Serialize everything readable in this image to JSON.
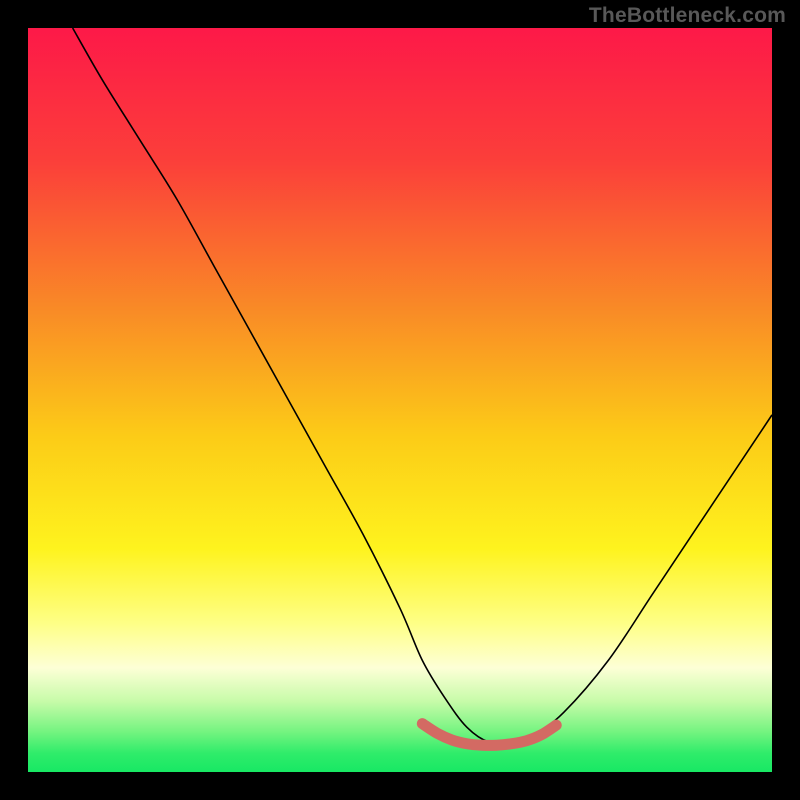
{
  "watermark": "TheBottleneck.com",
  "colors": {
    "black": "#000000",
    "curve": "#000000",
    "salmon": "#d36a63",
    "green": "#18e864"
  },
  "chart_data": {
    "type": "line",
    "title": "",
    "xlabel": "",
    "ylabel": "",
    "xlim": [
      0,
      100
    ],
    "ylim": [
      0,
      100
    ],
    "gradient_stops": [
      {
        "offset": 0.0,
        "color": "#fd1948"
      },
      {
        "offset": 0.18,
        "color": "#fb3f3a"
      },
      {
        "offset": 0.38,
        "color": "#f98b26"
      },
      {
        "offset": 0.55,
        "color": "#fccc17"
      },
      {
        "offset": 0.7,
        "color": "#fef31e"
      },
      {
        "offset": 0.8,
        "color": "#feff86"
      },
      {
        "offset": 0.86,
        "color": "#fdffd6"
      },
      {
        "offset": 0.905,
        "color": "#c7fba9"
      },
      {
        "offset": 0.945,
        "color": "#76f481"
      },
      {
        "offset": 0.975,
        "color": "#2fec6a"
      },
      {
        "offset": 1.0,
        "color": "#18e864"
      }
    ],
    "series": [
      {
        "name": "bottleneck-curve",
        "x": [
          6,
          10,
          15,
          20,
          25,
          30,
          35,
          40,
          45,
          50,
          53,
          56,
          59,
          62,
          65,
          68,
          72,
          78,
          84,
          90,
          96,
          100
        ],
        "y": [
          100,
          93,
          85,
          77,
          68,
          59,
          50,
          41,
          32,
          22,
          15,
          10,
          6,
          4,
          4,
          5,
          8,
          15,
          24,
          33,
          42,
          48
        ]
      },
      {
        "name": "optimal-range-marker",
        "x": [
          53,
          55,
          57,
          59,
          61,
          63,
          65,
          67,
          69,
          71
        ],
        "y": [
          6.5,
          5.2,
          4.3,
          3.8,
          3.6,
          3.6,
          3.8,
          4.2,
          5.0,
          6.3
        ]
      }
    ],
    "annotations": []
  }
}
